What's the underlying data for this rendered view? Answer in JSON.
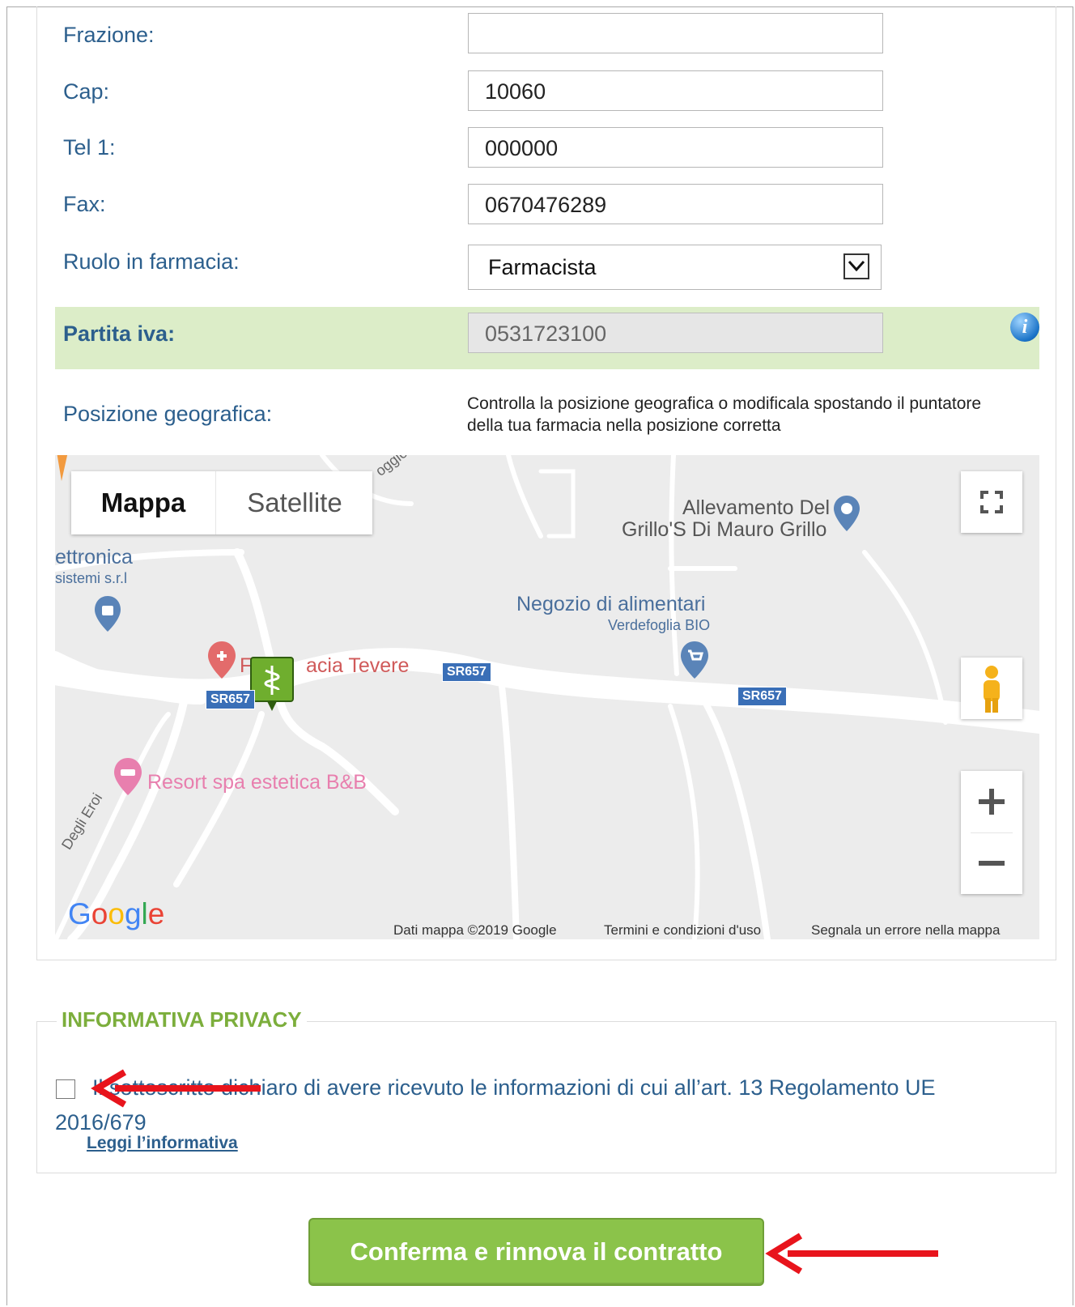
{
  "form": {
    "frazione": {
      "label": "Frazione:",
      "value": ""
    },
    "cap": {
      "label": "Cap:",
      "value": "10060"
    },
    "tel1": {
      "label": "Tel 1:",
      "value": "000000"
    },
    "fax": {
      "label": "Fax:",
      "value": "0670476289"
    },
    "ruolo": {
      "label": "Ruolo in farmacia:",
      "value": "Farmacista"
    },
    "partita_iva": {
      "label": "Partita iva:",
      "value": "0531723100"
    },
    "posizione": {
      "label": "Posizione geografica:",
      "help": "Controlla la posizione geografica o modificala spostando il puntatore della tua farmacia nella posizione corretta"
    }
  },
  "map": {
    "type_buttons": {
      "map": "Mappa",
      "satellite": "Satellite"
    },
    "pois": {
      "allevamento_line1": "Allevamento Del",
      "allevamento_line2": "Grillo'S Di Mauro Grillo",
      "elettronica_line1": "ettronica",
      "elettronica_line2": "sistemi s.r.l",
      "negozio_line1": "Negozio di alimentari",
      "negozio_line2": "Verdefoglia BIO",
      "farmacia": "acia Tevere",
      "farmacia_prefix": "F",
      "resort": "Resort spa estetica B&B",
      "street1": "oggio",
      "street2": "Degli Eroi"
    },
    "road_shields": [
      "SR657",
      "SR657",
      "SR657"
    ],
    "logo": "Google",
    "attribution": {
      "data": "Dati mappa ©2019 Google",
      "terms": "Termini e condizioni d'uso",
      "report": "Segnala un errore nella mappa"
    },
    "colors": {
      "background": "#ececec",
      "road": "#ffffff",
      "poi_blue": "#5a84b8",
      "poi_red": "#d9534f",
      "poi_pink": "#e87fae",
      "marker": "#6fae2e"
    }
  },
  "privacy": {
    "title": "INFORMATIVA PRIVACY",
    "text": "Il sottoscritto dichiaro di avere ricevuto le informazioni di cui all’art. 13 Regolamento UE 2016/679",
    "link": "Leggi l’informativa"
  },
  "submit": {
    "label": "Conferma e rinnova il contratto"
  },
  "colors": {
    "label": "#2c5f8d",
    "accent_green": "#8bc34a",
    "band": "#dcedc8",
    "arrow_red": "#e8141c"
  }
}
